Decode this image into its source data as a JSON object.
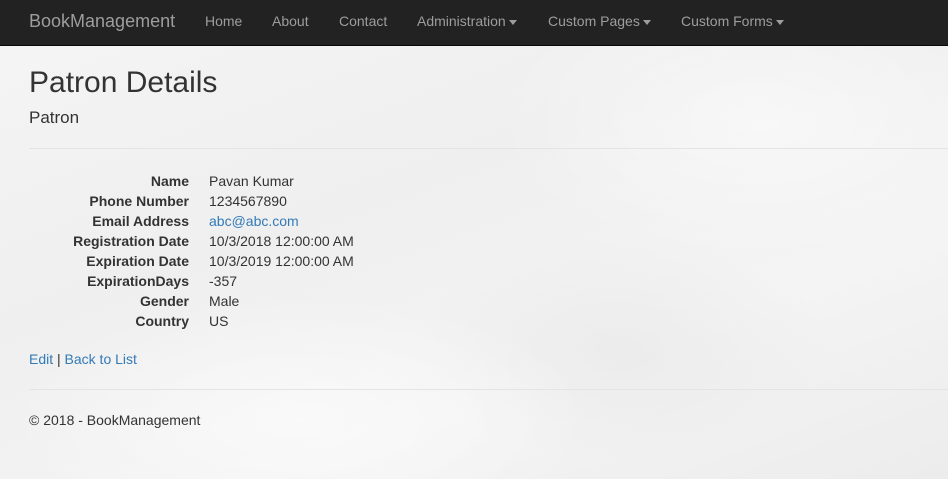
{
  "navbar": {
    "brand": "BookManagement",
    "items": [
      {
        "label": "Home"
      },
      {
        "label": "About"
      },
      {
        "label": "Contact"
      },
      {
        "label": "Administration"
      },
      {
        "label": "Custom Pages"
      },
      {
        "label": "Custom Forms"
      }
    ]
  },
  "page": {
    "title": "Patron Details",
    "subtitle": "Patron"
  },
  "details": [
    {
      "label": "Name",
      "value": "Pavan Kumar"
    },
    {
      "label": "Phone Number",
      "value": "1234567890"
    },
    {
      "label": "Email Address",
      "value": "abc@abc.com"
    },
    {
      "label": "Registration Date",
      "value": "10/3/2018 12:00:00 AM"
    },
    {
      "label": "Expiration Date",
      "value": "10/3/2019 12:00:00 AM"
    },
    {
      "label": "ExpirationDays",
      "value": "-357"
    },
    {
      "label": "Gender",
      "value": "Male"
    },
    {
      "label": "Country",
      "value": "US"
    }
  ],
  "actions": {
    "edit_label": "Edit",
    "separator": "|",
    "back_label": "Back to List"
  },
  "footer": {
    "text": "© 2018 - BookManagement"
  },
  "colors": {
    "navbar_bg": "#222222",
    "nav_text": "#9d9d9d",
    "link": "#337ab7",
    "text": "#333333"
  }
}
